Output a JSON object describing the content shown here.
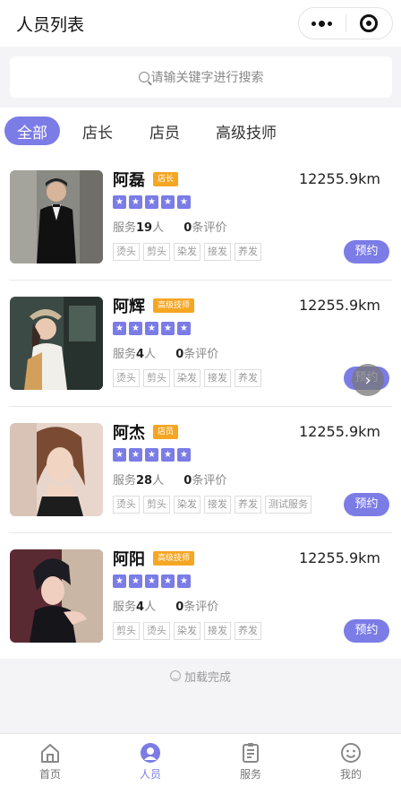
{
  "header": {
    "title": "人员列表"
  },
  "search": {
    "placeholder": "请输关键字进行搜索"
  },
  "tabs": [
    {
      "label": "全部",
      "active": true
    },
    {
      "label": "店长",
      "active": false
    },
    {
      "label": "店员",
      "active": false
    },
    {
      "label": "高级技师",
      "active": false
    }
  ],
  "staff": [
    {
      "name": "阿磊",
      "badge": "店长",
      "distance": "12255.9km",
      "stars": 5,
      "service_label": "服务",
      "service_count": "19",
      "service_unit": "人",
      "review_count": "0",
      "review_label": "条评价",
      "tags": [
        "烫头",
        "剪头",
        "染发",
        "接发",
        "养发"
      ],
      "book_label": "预约"
    },
    {
      "name": "阿辉",
      "badge": "高级技师",
      "distance": "12255.9km",
      "stars": 5,
      "service_label": "服务",
      "service_count": "4",
      "service_unit": "人",
      "review_count": "0",
      "review_label": "条评价",
      "tags": [
        "烫头",
        "剪头",
        "染发",
        "接发",
        "养发"
      ],
      "book_label": "预约"
    },
    {
      "name": "阿杰",
      "badge": "店员",
      "distance": "12255.9km",
      "stars": 5,
      "service_label": "服务",
      "service_count": "28",
      "service_unit": "人",
      "review_count": "0",
      "review_label": "条评价",
      "tags": [
        "烫头",
        "剪头",
        "染发",
        "接发",
        "养发",
        "测试服务"
      ],
      "book_label": "预约"
    },
    {
      "name": "阿阳",
      "badge": "高级技师",
      "distance": "12255.9km",
      "stars": 5,
      "service_label": "服务",
      "service_count": "4",
      "service_unit": "人",
      "review_count": "0",
      "review_label": "条评价",
      "tags": [
        "剪头",
        "烫头",
        "染发",
        "接发",
        "养发"
      ],
      "book_label": "预约"
    }
  ],
  "footer_status": "加载完成",
  "bottom_nav": [
    {
      "label": "首页",
      "icon": "home-icon",
      "active": false
    },
    {
      "label": "人员",
      "icon": "person-icon",
      "active": true
    },
    {
      "label": "服务",
      "icon": "clipboard-icon",
      "active": false
    },
    {
      "label": "我的",
      "icon": "smiley-icon",
      "active": false
    }
  ],
  "colors": {
    "accent": "#7b7ce6",
    "badge": "#f5a623",
    "background": "#f4f4f6"
  }
}
